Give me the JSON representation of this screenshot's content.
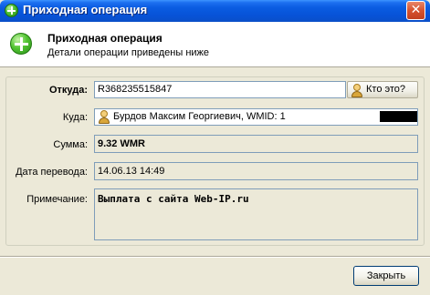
{
  "window": {
    "title": "Приходная операция",
    "close_glyph": "✕"
  },
  "header": {
    "title": "Приходная операция",
    "subtitle": "Детали операции приведены ниже",
    "icon": "plus-circle-icon"
  },
  "form": {
    "from": {
      "label": "Откуда:",
      "value": "R368235515847",
      "who_button": "Кто это?"
    },
    "to": {
      "label": "Куда:",
      "value": "Бурдов Максим Георгиевич, WMID: 1"
    },
    "amount": {
      "label": "Сумма:",
      "value": "9.32 WMR"
    },
    "date": {
      "label": "Дата перевода:",
      "value": "14.06.13 14:49"
    },
    "note": {
      "label": "Примечание:",
      "value": "Выплата с сайта Web-IP.ru"
    }
  },
  "footer": {
    "close_button": "Закрыть"
  },
  "colors": {
    "titlebar": "#0a5ce1",
    "accent_green": "#4cbf32",
    "window_bg": "#ece9d8",
    "field_border": "#7f9db9"
  }
}
